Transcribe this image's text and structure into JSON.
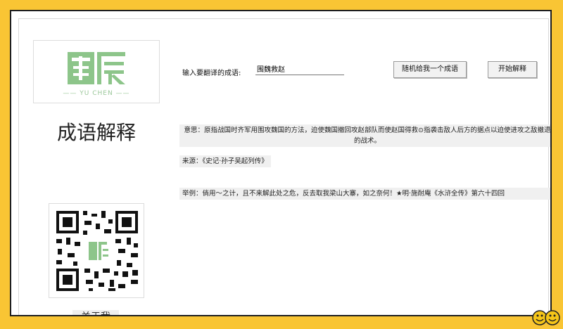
{
  "logo": {
    "mark_text": "围辰",
    "sub_text": "—— YU CHEN ——"
  },
  "page_title": "成语解释",
  "form": {
    "input_label": "输入要翻译的成语:",
    "input_value": "围魏救赵",
    "random_button": "随机给我一个成语",
    "start_button": "开始解释"
  },
  "result": {
    "meaning": "意思：原指战国时齐军用围攻魏国的方法，迫使魏国撤回攻赵部队而使赵国得救⊙指袭击敌人后方的据点以迫使进攻之敌撤退的战术。",
    "source": "来源：《史记·孙子吴起列传》",
    "example": "举例：倘用～之计，且不来解此处之危，反去取我梁山大寨，如之奈何！★明·施耐庵《水浒全传》第六十四回"
  },
  "sidebar": {
    "about_label": "关于我"
  },
  "colors": {
    "background": "#f9c534",
    "logo_green": "#8dc58a",
    "button_bg": "#f2f2f2"
  },
  "icons": [
    "logo-icon",
    "qr-code-icon",
    "smiley-face-icon"
  ]
}
